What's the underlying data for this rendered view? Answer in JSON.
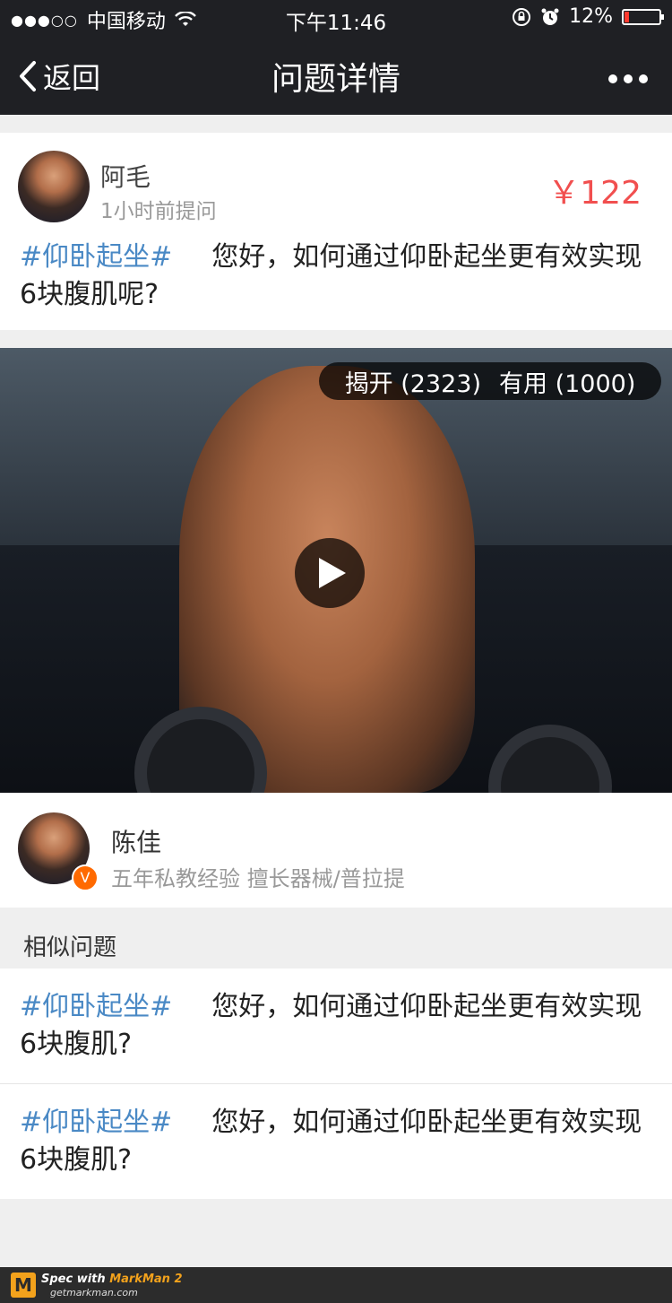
{
  "status_bar": {
    "signal": "●●●○○",
    "carrier": "中国移动",
    "time": "下午11:46",
    "battery": "12%",
    "battery_level": 0.12
  },
  "nav": {
    "back_label": "返回",
    "title": "问题详情",
    "more_icon": "more-dots"
  },
  "question": {
    "author": "阿毛",
    "time_ago": "1小时前提问",
    "price": "￥122",
    "tag": "#仰卧起坐#",
    "text": "您好，如何通过仰卧起坐更有效实现6块腹肌呢?"
  },
  "media": {
    "reveal_label": "揭开 (2323)",
    "useful_label": "有用 (1000)"
  },
  "answerer": {
    "name": "陈佳",
    "verified_badge": "V",
    "description": "五年私教经验   擅长器械/普拉提"
  },
  "similar": {
    "header": "相似问题",
    "items": [
      {
        "tag": "#仰卧起坐#",
        "text": "您好，如何通过仰卧起坐更有效实现6块腹肌?"
      },
      {
        "tag": "#仰卧起坐#",
        "text": "您好，如何通过仰卧起坐更有效实现6块腹肌?"
      }
    ]
  },
  "footer": {
    "logo_letter": "M",
    "spec_with": "Spec with ",
    "brand": "MarkMan 2",
    "site": "getmarkman.com"
  },
  "colors": {
    "nav_bg": "#1f2024",
    "price": "#f14f4f",
    "tag": "#4a89c5",
    "verified": "#ff6a00"
  }
}
